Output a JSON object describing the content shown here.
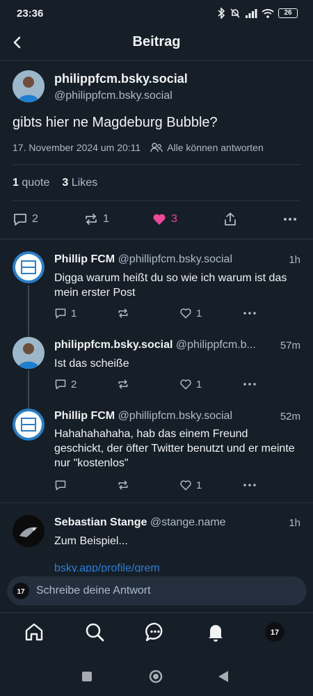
{
  "status": {
    "time": "23:36",
    "battery": "26"
  },
  "header": {
    "title": "Beitrag"
  },
  "post": {
    "author_name": "philippfcm.bsky.social",
    "author_handle": "@philippfcm.bsky.social",
    "text": "gibts hier ne Magdeburg Bubble?",
    "date": "17. November 2024 um 20:11",
    "reply_setting": "Alle können antworten",
    "quotes_count": "1",
    "quotes_label": "quote",
    "likes_count": "3",
    "likes_label": "Likes",
    "reply_count": "2",
    "repost_count": "1",
    "like_count": "3"
  },
  "replies": [
    {
      "name": "Phillip FCM",
      "handle": "@phillipfcm.bsky.social",
      "time": "1h",
      "text": "Digga warum heißt du so wie ich warum ist das mein erster Post",
      "reply_count": "1",
      "like_count": "1",
      "avatar": "1fc-logo"
    },
    {
      "name": "philippfcm.bsky.social",
      "handle": "@philippfcm.b...",
      "time": "57m",
      "text": "Ist das scheiße",
      "reply_count": "2",
      "like_count": "1",
      "avatar": "profile-photo"
    },
    {
      "name": "Phillip FCM",
      "handle": "@phillipfcm.bsky.social",
      "time": "52m",
      "text": "Hahahahahaha, hab das einem Freund geschickt, der öfter Twitter benutzt und er meinte nur \"kostenlos\"",
      "reply_count": "",
      "like_count": "1",
      "avatar": "1fc-logo"
    },
    {
      "name": "Sebastian Stange",
      "handle": "@stange.name",
      "time": "1h",
      "text": "Zum Beispiel...",
      "link": "bsky.app/profile/grem",
      "avatar": "bird-photo"
    }
  ],
  "composer": {
    "placeholder": "Schreibe deine Antwort"
  },
  "colors": {
    "accent_like": "#ec4899",
    "link": "#2c7fd6",
    "background": "#161e27"
  }
}
